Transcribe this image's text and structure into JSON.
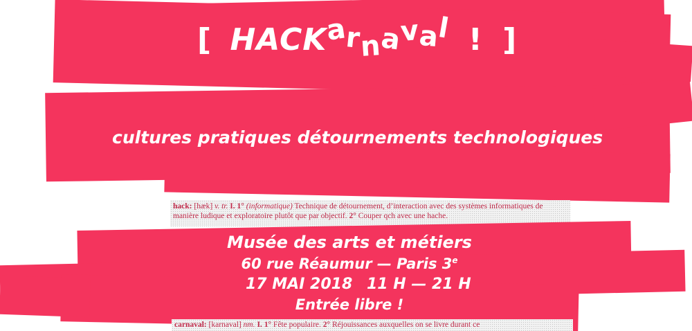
{
  "title": {
    "open_bracket": "[",
    "hack": "HACK",
    "letters": [
      "a",
      "r",
      "n",
      "a",
      "v",
      "a",
      "l"
    ],
    "exclamation": "!",
    "close_bracket": "]"
  },
  "subtitle": "cultures pratiques  détournements technologiques",
  "dictionary_hack": {
    "headword": "hack:",
    "pron": "[hæk]",
    "gram": "v. tr.",
    "roman": "I.",
    "n1": "1°",
    "domain": "(informatique)",
    "def1": "Technique de détournement, d’interaction avec des systèmes informatiques de manière ludique et exploratoire plutôt que par objectif.",
    "n2": "2°",
    "def2": "Couper qch avec une hache."
  },
  "info": {
    "venue": "Musée des arts et métiers",
    "address": "60 rue Réaumur — Paris 3",
    "address_sup": "e",
    "date": "17 MAI 2018",
    "hours": "11 H — 21 H",
    "entry": "Entrée libre !"
  },
  "dictionary_carnaval": {
    "headword": "carnaval:",
    "pron": "[karnaval]",
    "gram": "nm.",
    "roman": "I.",
    "n1": "1°",
    "def1": "Fête populaire.",
    "n2": "2°",
    "def2": "Réjouissances auxquelles on se livre durant ce"
  },
  "colors": {
    "accent": "#f4345d",
    "text_on_accent": "#ffffff",
    "dictionary_text": "#c02a4a"
  }
}
